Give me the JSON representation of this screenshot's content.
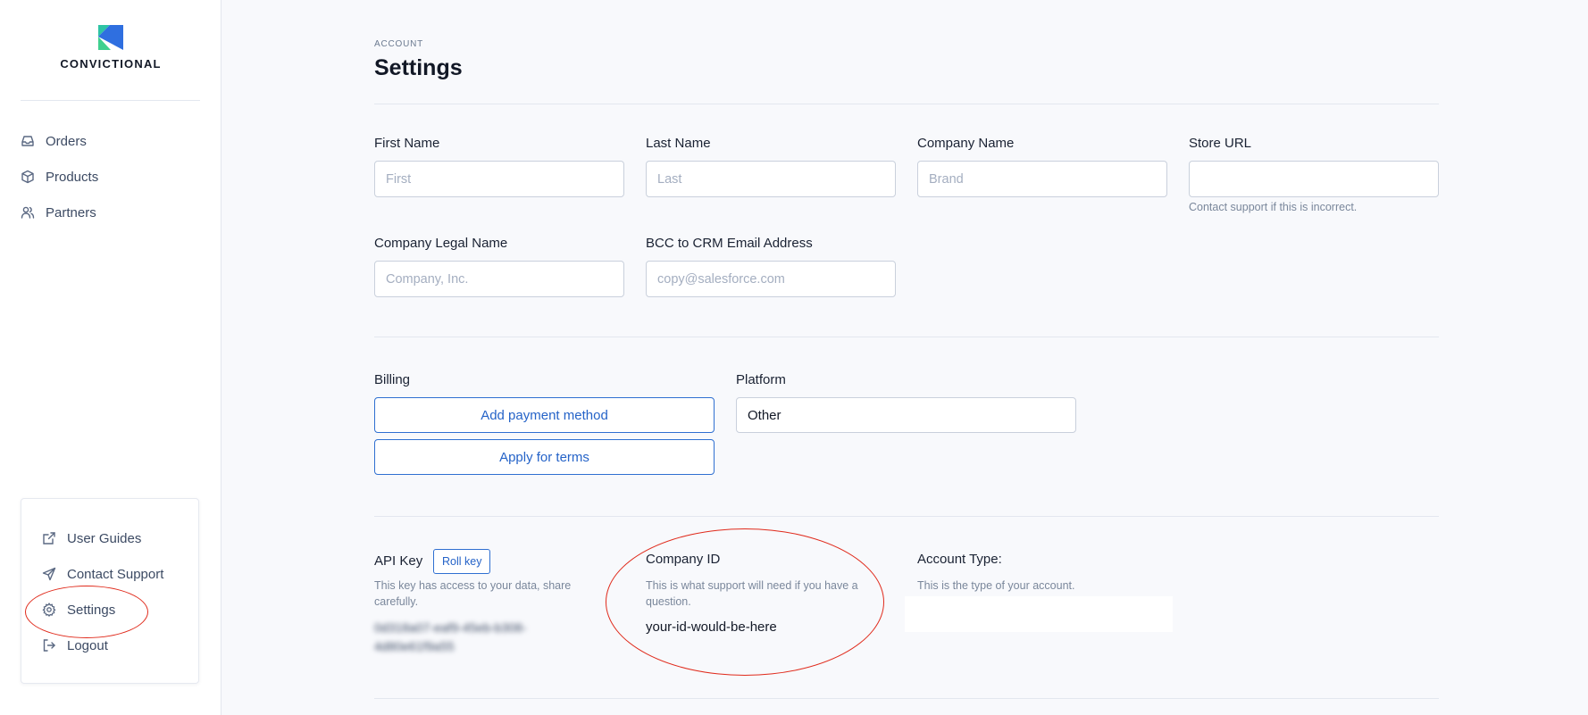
{
  "brand": {
    "name": "CONVICTIONAL"
  },
  "sidebar": {
    "items": [
      {
        "label": "Orders",
        "icon": "inbox-icon"
      },
      {
        "label": "Products",
        "icon": "box-icon"
      },
      {
        "label": "Partners",
        "icon": "users-icon"
      }
    ],
    "support": [
      {
        "label": "User Guides",
        "icon": "external-link-icon"
      },
      {
        "label": "Contact Support",
        "icon": "send-icon"
      },
      {
        "label": "Settings",
        "icon": "gear-icon"
      },
      {
        "label": "Logout",
        "icon": "logout-icon"
      }
    ]
  },
  "header": {
    "eyebrow": "ACCOUNT",
    "title": "Settings"
  },
  "form": {
    "first_name": {
      "label": "First Name",
      "placeholder": "First",
      "value": ""
    },
    "last_name": {
      "label": "Last Name",
      "placeholder": "Last",
      "value": ""
    },
    "company_name": {
      "label": "Company Name",
      "placeholder": "Brand",
      "value": ""
    },
    "store_url": {
      "label": "Store URL",
      "placeholder": "",
      "value": "",
      "hint": "Contact support if this is incorrect."
    },
    "legal_name": {
      "label": "Company Legal Name",
      "placeholder": "Company, Inc.",
      "value": ""
    },
    "bcc_email": {
      "label": "BCC to CRM Email Address",
      "placeholder": "copy@salesforce.com",
      "value": ""
    }
  },
  "billing": {
    "label": "Billing",
    "add_payment": "Add payment method",
    "apply_terms": "Apply for terms"
  },
  "platform": {
    "label": "Platform",
    "selected": "Other"
  },
  "api": {
    "label": "API Key",
    "roll_label": "Roll key",
    "description": "This key has access to your data, share carefully.",
    "key_line1": "0d318a07-eaf9-45eb-b308-",
    "key_line2": "4d80e61f9a55"
  },
  "company_id": {
    "label": "Company ID",
    "description": "This is what support will need if you have a question.",
    "value": "your-id-would-be-here"
  },
  "account_type": {
    "label": "Account Type:",
    "description": "This is the type of your account.",
    "value": ""
  },
  "colors": {
    "accent": "#2563c8",
    "annotation": "#e02a1b",
    "background": "#f8f9fc"
  }
}
